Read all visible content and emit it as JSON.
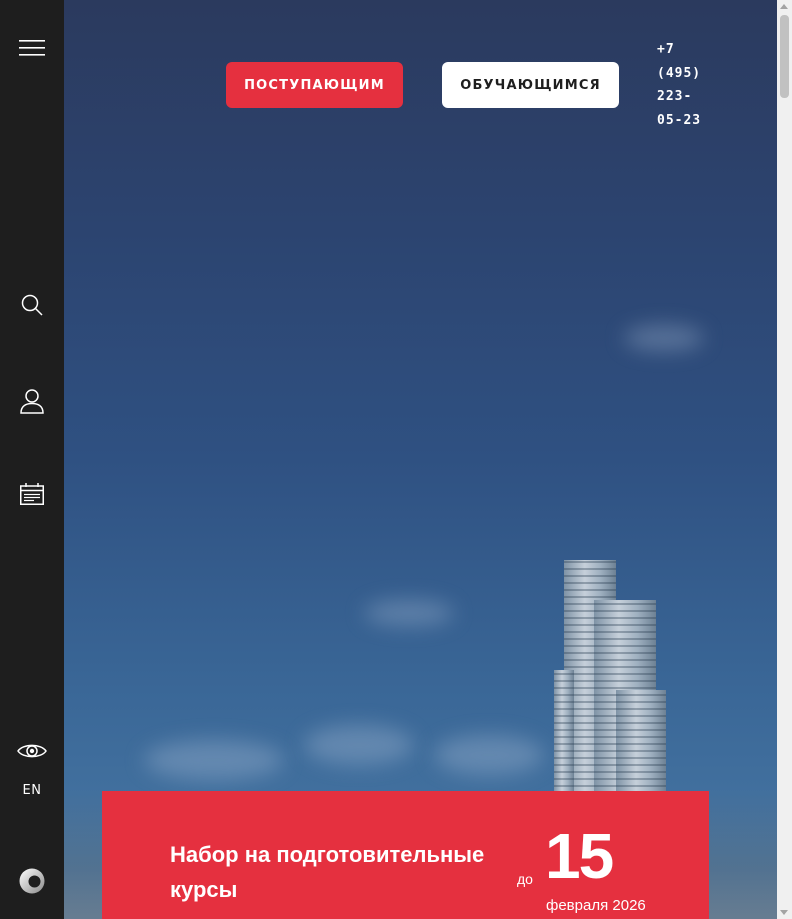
{
  "header": {
    "applicants_button": "ПОСТУПАЮЩИМ",
    "students_button": "ОБУЧАЮЩИМСЯ",
    "phone_lines": [
      "+7",
      "(495)",
      "223-",
      "05-23"
    ]
  },
  "sidebar": {
    "icons": [
      "menu-icon",
      "search-icon",
      "user-icon",
      "calendar-icon",
      "eye-icon",
      "logo-icon"
    ],
    "language": "EN"
  },
  "promo": {
    "title": "Набор на подготовительные курсы",
    "until_label": "до",
    "day": "15",
    "month_year": "февраля 2026"
  },
  "colors": {
    "accent": "#e5303f",
    "sidebar_bg": "#1e1e1e",
    "white": "#ffffff"
  }
}
